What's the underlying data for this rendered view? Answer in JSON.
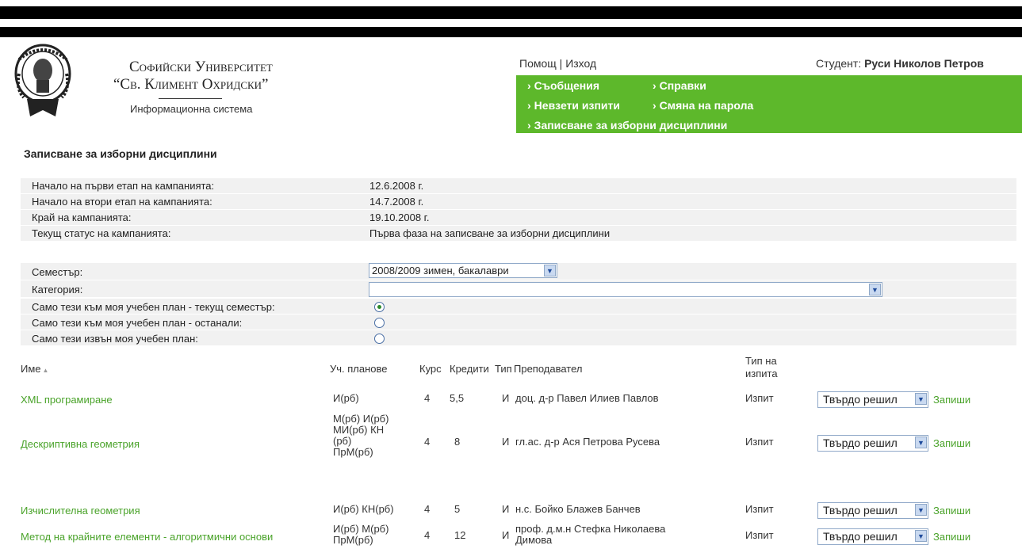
{
  "header": {
    "university_line1": "Софийски Университет",
    "university_line2": "“Св. Климент Охридски”",
    "subtitle": "Информационна система",
    "help_exit": "Помощ | Изход",
    "student_label": "Студент:",
    "student_name": "Руси Николов Петров"
  },
  "nav": {
    "messages": "Съобщения",
    "reports": "Справки",
    "unpassed_exams": "Невзети изпити",
    "change_password": "Смяна на парола",
    "elective_enrollment": "Записване за изборни дисциплини"
  },
  "page_title": "Записване за изборни дисциплини",
  "campaign": {
    "rows": [
      {
        "label": "Начало на първи етап на кампанията:",
        "value": "12.6.2008 г."
      },
      {
        "label": "Начало на втори етап на кампанията:",
        "value": "14.7.2008 г."
      },
      {
        "label": "Край на кампанията:",
        "value": "19.10.2008 г."
      },
      {
        "label": "Текущ статус на кампанията:",
        "value": "Първа фаза на записване за изборни дисциплини"
      }
    ]
  },
  "filters": {
    "semester_label": "Семестър:",
    "semester_value": "2008/2009 зимен, бакалаври",
    "category_label": "Категория:",
    "category_value": "",
    "opt_current": "Само тези към моя учебен план - текущ семестър:",
    "opt_remaining": "Само тези към моя учебен план - останали:",
    "opt_outside": "Само тези извън моя учебен план:",
    "selected_option": "current"
  },
  "table": {
    "headers": {
      "name": "Име",
      "plans": "Уч. планове",
      "course": "Курс",
      "credits": "Кредити",
      "type": "Тип",
      "lecturer": "Преподавател",
      "exam_type_line1": "Тип на",
      "exam_type_line2": "изпита"
    },
    "rows": [
      {
        "name": "XML програмиране",
        "plans": [
          "И(рб)"
        ],
        "course": "4",
        "credits": "5,5",
        "type": "И",
        "lecturer": [
          "доц. д-р Павел Илиев Павлов"
        ],
        "exam": "Изпит",
        "choice": "Твърдо решил",
        "action": "Запиши"
      },
      {
        "name": "Дескриптивна геометрия",
        "plans": [
          "М(рб) И(рб)",
          "МИ(рб) КН",
          "(рб)",
          "ПрМ(рб)"
        ],
        "course": "4",
        "credits": "8",
        "type": "И",
        "lecturer": [
          "гл.ас. д-р Ася Петрова Русева"
        ],
        "exam": "Изпит",
        "choice": "Твърдо решил",
        "action": "Запиши"
      },
      {
        "name": "Изчислителна геометрия",
        "plans": [
          "И(рб) КН(рб)"
        ],
        "course": "4",
        "credits": "5",
        "type": "И",
        "lecturer": [
          "н.с. Бойко Блажев Банчев"
        ],
        "exam": "Изпит",
        "choice": "Твърдо решил",
        "action": "Запиши"
      },
      {
        "name": "Метод на крайните елементи - алгоритмични основи",
        "plans": [
          "И(рб) М(рб)",
          "ПрМ(рб)"
        ],
        "course": "4",
        "credits": "12",
        "type": "И",
        "lecturer": [
          "проф. д.м.н Стефка Николаева",
          "Димова"
        ],
        "exam": "Изпит",
        "choice": "Твърдо решил",
        "action": "Запиши"
      }
    ]
  },
  "colors": {
    "nav_green": "#5db82b",
    "link_green": "#4aa32a"
  }
}
